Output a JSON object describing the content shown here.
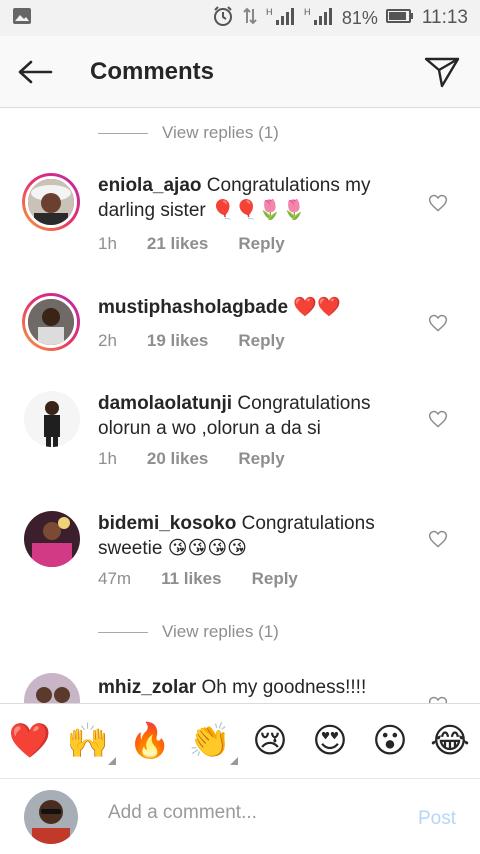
{
  "status_bar": {
    "battery": "81%",
    "time": "11:13",
    "icons": [
      "gallery-icon",
      "alarm-icon",
      "data-transfer-icon",
      "signal-h-icon",
      "signal-h-icon",
      "battery-icon"
    ]
  },
  "header": {
    "title": "Comments"
  },
  "view_replies_1": "View replies (1)",
  "view_replies_2": "View replies (1)",
  "comments": [
    {
      "username": "eniola_ajao",
      "text": "Congratulations my darling sister 🎈🎈🌷🌷",
      "time": "1h",
      "likes": "21 likes",
      "reply": "Reply"
    },
    {
      "username": "mustiphasholagbade",
      "text": "❤️❤️",
      "time": "2h",
      "likes": "19 likes",
      "reply": "Reply"
    },
    {
      "username": "damolaolatunji",
      "text": "Congratulations olorun a wo ,olorun a da si",
      "time": "1h",
      "likes": "20 likes",
      "reply": "Reply"
    },
    {
      "username": "bidemi_kosoko",
      "text": "Congratulations sweetie 😘😘😘😘",
      "time": "47m",
      "likes": "11 likes",
      "reply": "Reply"
    },
    {
      "username": "mhiz_zolar",
      "text": "Oh my goodness!!!!"
    }
  ],
  "reactions": [
    "❤️",
    "🙌",
    "🔥",
    "👏",
    "😢",
    "😍",
    "😮",
    "😂"
  ],
  "composer": {
    "placeholder": "Add a comment...",
    "post_label": "Post"
  },
  "colors": {
    "story_ring_start": "#f9a33a",
    "story_ring_end": "#b62ab0",
    "post_disabled": "#b3d7f8",
    "meta_gray": "#8e8e8e"
  }
}
